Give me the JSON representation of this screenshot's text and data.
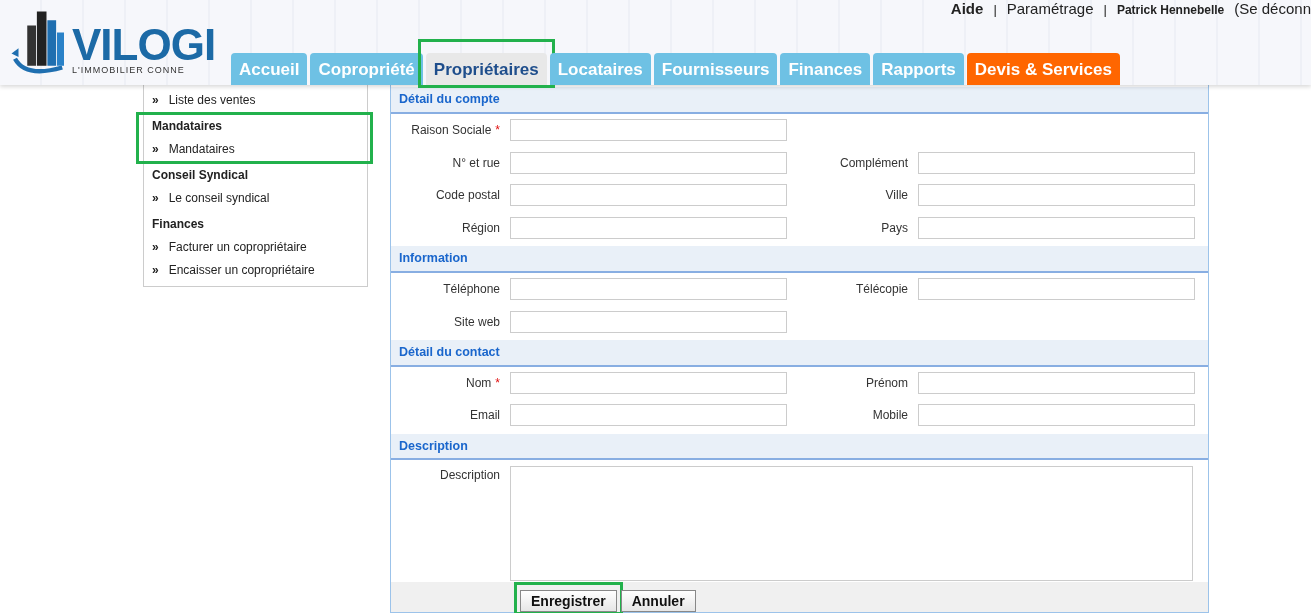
{
  "logo": {
    "name": "VILOGI",
    "tagline": "L'IMMOBILIER CONNE"
  },
  "top_links": [
    {
      "label": "Aide",
      "kind": "link"
    },
    {
      "label": "|",
      "kind": "sep"
    },
    {
      "label": "Paramétrage",
      "kind": "link"
    },
    {
      "label": "|",
      "kind": "sep"
    },
    {
      "label": "Patrick Hennebelle",
      "kind": "user"
    },
    {
      "label": "(Se déconn",
      "kind": "link"
    }
  ],
  "tabs": [
    {
      "label": "Accueil",
      "selected": false,
      "kind": "normal",
      "highlighted": false
    },
    {
      "label": "Copropriété",
      "selected": false,
      "kind": "normal",
      "highlighted": false
    },
    {
      "label": "Propriétaires",
      "selected": true,
      "kind": "normal",
      "highlighted": true
    },
    {
      "label": "Locataires",
      "selected": false,
      "kind": "normal",
      "highlighted": false
    },
    {
      "label": "Fournisseurs",
      "selected": false,
      "kind": "normal",
      "highlighted": false
    },
    {
      "label": "Finances",
      "selected": false,
      "kind": "normal",
      "highlighted": false
    },
    {
      "label": "Rapports",
      "selected": false,
      "kind": "normal",
      "highlighted": false
    },
    {
      "label": "Devis & Services",
      "selected": false,
      "kind": "service",
      "highlighted": false
    }
  ],
  "sidebar": {
    "groups": [
      {
        "items": [
          "Liste des ventes"
        ]
      },
      {
        "heading": "Mandataires",
        "highlighted": true,
        "items": [
          "Mandataires"
        ]
      },
      {
        "heading": "Conseil Syndical",
        "items": [
          "Le conseil syndical"
        ]
      },
      {
        "heading": "Finances",
        "items": [
          "Facturer un copropriétaire",
          "Encaisser un copropriétaire"
        ]
      }
    ]
  },
  "bullet": "»",
  "form": {
    "sections": [
      {
        "title": "Détail du compte",
        "rows": [
          [
            {
              "label": "Raison Sociale",
              "required": true,
              "kind": "input"
            }
          ],
          [
            {
              "label": "N° et rue",
              "required": false,
              "kind": "input"
            },
            {
              "label": "Complément",
              "required": false,
              "kind": "input"
            }
          ],
          [
            {
              "label": "Code postal",
              "required": false,
              "kind": "input"
            },
            {
              "label": "Ville",
              "required": false,
              "kind": "input"
            }
          ],
          [
            {
              "label": "Région",
              "required": false,
              "kind": "input"
            },
            {
              "label": "Pays",
              "required": false,
              "kind": "input"
            }
          ]
        ]
      },
      {
        "title": "Information",
        "rows": [
          [
            {
              "label": "Téléphone",
              "required": false,
              "kind": "input"
            },
            {
              "label": "Télécopie",
              "required": false,
              "kind": "input"
            }
          ],
          [
            {
              "label": "Site web",
              "required": false,
              "kind": "input"
            }
          ]
        ]
      },
      {
        "title": "Détail du contact",
        "rows": [
          [
            {
              "label": "Nom",
              "required": true,
              "kind": "input"
            },
            {
              "label": "Prénom",
              "required": false,
              "kind": "input"
            }
          ],
          [
            {
              "label": "Email",
              "required": false,
              "kind": "input"
            },
            {
              "label": "Mobile",
              "required": false,
              "kind": "input"
            }
          ]
        ]
      },
      {
        "title": "Description",
        "rows": [
          [
            {
              "label": "Description",
              "required": false,
              "kind": "textarea"
            }
          ]
        ]
      }
    ],
    "required_mark": "*",
    "buttons": [
      {
        "label": "Enregistrer",
        "highlighted": true
      },
      {
        "label": "Annuler",
        "highlighted": false
      }
    ]
  }
}
